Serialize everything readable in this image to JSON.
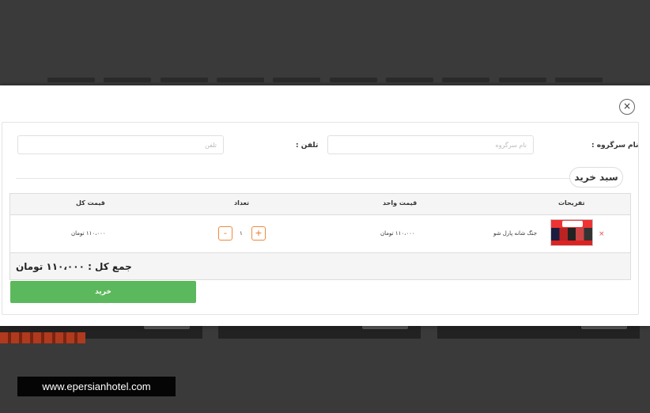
{
  "watermark": "www.epersianhotel.com",
  "modal": {
    "close_icon": "×",
    "form": {
      "leader_name_label": "نام سرگروه :",
      "leader_name_placeholder": "نام سرگروه",
      "phone_label": "تلفن :",
      "phone_placeholder": "تلفن"
    },
    "cart": {
      "title": "سبد خرید",
      "headers": {
        "item": "تفریحات",
        "unit_price": "قیمت واحد",
        "quantity": "تعداد",
        "total_price": "قیمت کل"
      },
      "row": {
        "remove_icon": "×",
        "name": "جنگ شانه پارل شو",
        "unit_price": "۱۱۰،۰۰۰ تومان",
        "quantity": "۱",
        "total_price": "۱۱۰،۰۰۰ تومان",
        "plus": "+",
        "minus": "-"
      },
      "grand_total": "جمع کل : ۱۱۰،۰۰۰ تومان",
      "buy_label": "خرید"
    }
  },
  "colors": {
    "backdrop": "#3a3a3a",
    "buy_button": "#5cb85c",
    "qty_button_border": "#f08a3c",
    "remove": "#d9534f"
  }
}
